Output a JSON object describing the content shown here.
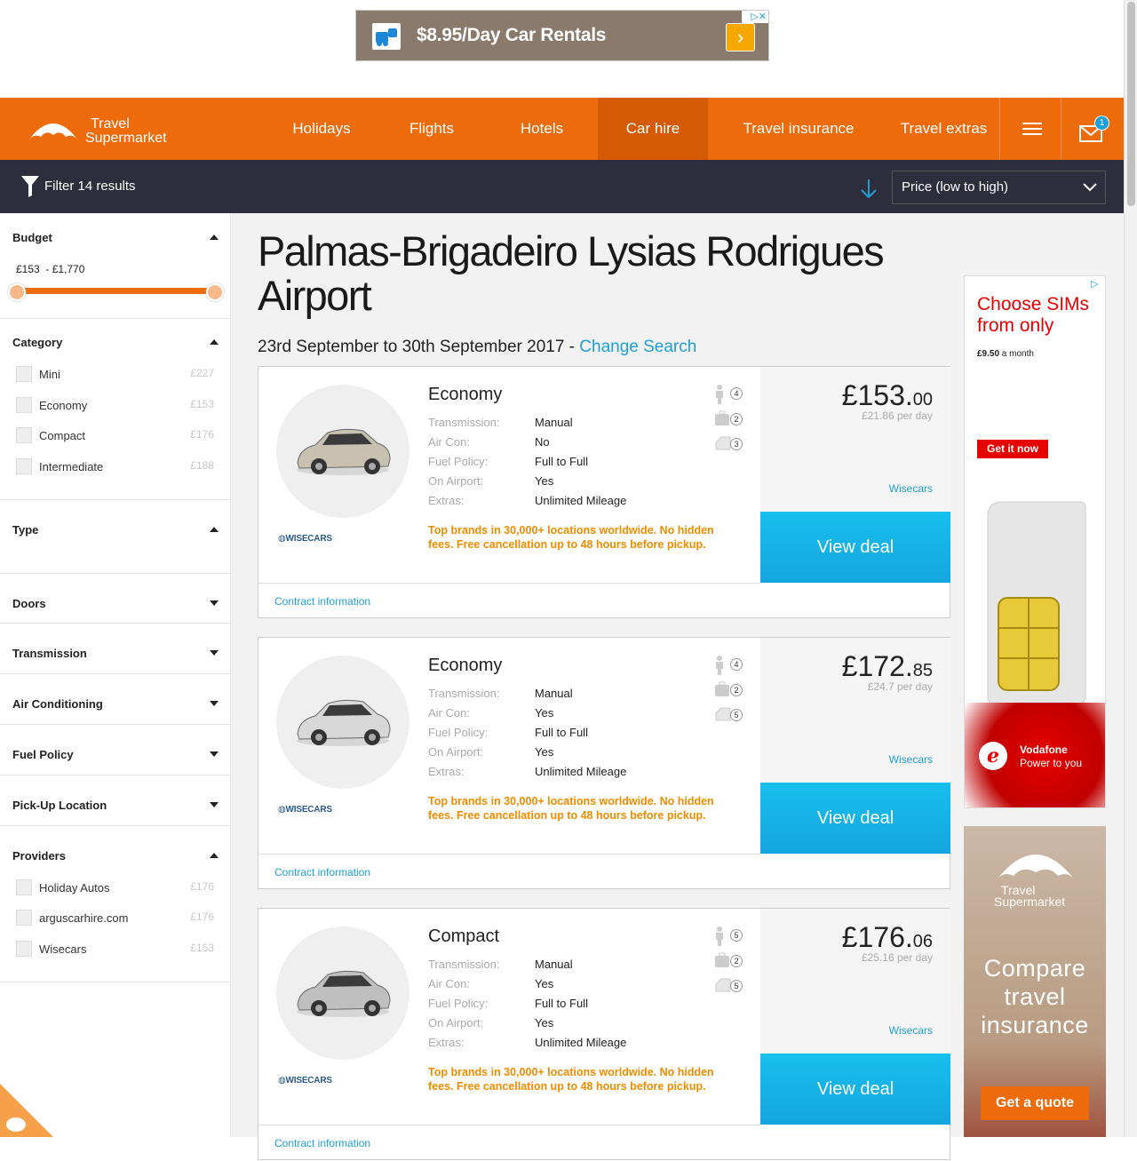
{
  "top_ad": {
    "text": "$8.95/Day Car Rentals",
    "arrow": "›"
  },
  "header": {
    "logo_line1": "Travel",
    "logo_line2": "Supermarket",
    "nav": [
      "Holidays",
      "Flights",
      "Hotels",
      "Car hire",
      "Travel insurance",
      "Travel extras"
    ],
    "active_nav": "Car hire",
    "notification_count": "1"
  },
  "filter_bar": {
    "filter_label": "Filter 14 results",
    "sort_selected": "Price (low to high)"
  },
  "sidebar": {
    "budget": {
      "title": "Budget",
      "range": "£153  - £1,770"
    },
    "category": {
      "title": "Category",
      "items": [
        {
          "label": "Mini",
          "price": "£227"
        },
        {
          "label": "Economy",
          "price": "£153"
        },
        {
          "label": "Compact",
          "price": "£176"
        },
        {
          "label": "Intermediate",
          "price": "£188"
        }
      ]
    },
    "type_title": "Type",
    "doors_title": "Doors",
    "transmission_title": "Transmission",
    "aircon_title": "Air Conditioning",
    "fuel_title": "Fuel Policy",
    "pickup_title": "Pick-Up Location",
    "providers": {
      "title": "Providers",
      "items": [
        {
          "label": "Holiday Autos",
          "price": "£176"
        },
        {
          "label": "arguscarhire.com",
          "price": "£176"
        },
        {
          "label": "Wisecars",
          "price": "£153"
        }
      ]
    }
  },
  "main": {
    "title": "Palmas-Brigadeiro Lysias Rodrigues Airport",
    "dates": "23rd September to 30th September 2017 - ",
    "change_search": "Change Search",
    "spec_keys": [
      "Transmission:",
      "Air Con:",
      "Fuel Policy:",
      "On Airport:",
      "Extras:"
    ],
    "promo": "Top brands in 30,000+ locations worldwide. No hidden fees. Free cancellation up to 48 hours before pickup.",
    "contract_label": "Contract information",
    "view_deal": "View deal",
    "brand_logo": "WISECARS",
    "results": [
      {
        "category": "Economy",
        "transmission": "Manual",
        "aircon": "No",
        "fuel": "Full to Full",
        "airport": "Yes",
        "extras": "Unlimited Mileage",
        "seats": "4",
        "bags": "2",
        "doors": "3",
        "price_whole": "£153.",
        "price_dec": "00",
        "per_day": "£21.86 per day",
        "supplier": "Wisecars",
        "car_color": "#c9c1b0"
      },
      {
        "category": "Economy",
        "transmission": "Manual",
        "aircon": "Yes",
        "fuel": "Full to Full",
        "airport": "Yes",
        "extras": "Unlimited Mileage",
        "seats": "4",
        "bags": "2",
        "doors": "5",
        "price_whole": "£172.",
        "price_dec": "85",
        "per_day": "£24.7 per day",
        "supplier": "Wisecars",
        "car_color": "#d8d8d8"
      },
      {
        "category": "Compact",
        "transmission": "Manual",
        "aircon": "Yes",
        "fuel": "Full to Full",
        "airport": "Yes",
        "extras": "Unlimited Mileage",
        "seats": "5",
        "bags": "2",
        "doors": "5",
        "price_whole": "£176.",
        "price_dec": "06",
        "per_day": "£25.16 per day",
        "supplier": "Wisecars",
        "car_color": "#bfbfbf"
      }
    ]
  },
  "ad_sim": {
    "headline": "Choose SIMs from only",
    "price": "£9.50",
    "price_suffix": " a month",
    "cta": "Get it now",
    "brand": "Vodafone",
    "tagline": "Power to you"
  },
  "ad_tsm": {
    "logo_line1": "Travel",
    "logo_line2": "Supermarket",
    "headline": "Compare travel insurance",
    "cta": "Get a quote"
  },
  "colors": {
    "brand_orange": "#ee6b0c",
    "filter_dark": "#2d2d3b",
    "link_blue": "#1e9fd8",
    "promo_orange": "#f08c00",
    "cta_blue": "#15a5df"
  }
}
